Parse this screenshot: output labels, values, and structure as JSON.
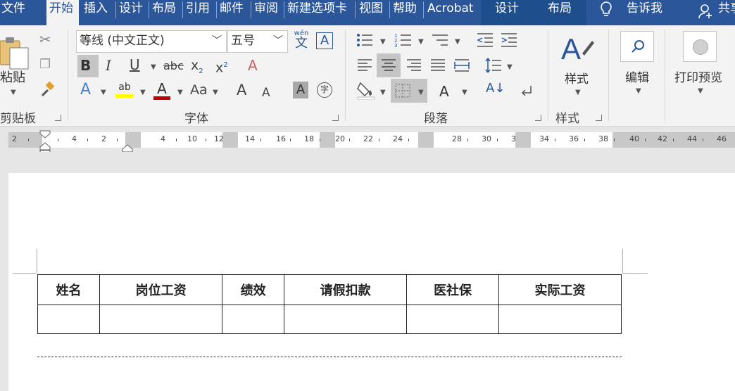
{
  "tabs": [
    "文件",
    "开始",
    "插入",
    "设计",
    "布局",
    "引用",
    "邮件",
    "审阅",
    "新建选项卡",
    "视图",
    "帮助",
    "Acrobat",
    "设计",
    "布局"
  ],
  "tell_me": "告诉我",
  "share": "共享",
  "clipboard": {
    "paste": "粘贴",
    "group": "剪贴板"
  },
  "font": {
    "name": "等线 (中文正文)",
    "size": "五号",
    "phonetic": "wén",
    "phonetic_char": "文",
    "char_border": "A",
    "group": "字体",
    "bold": "B",
    "italic": "I",
    "underline": "U",
    "strike": "abc",
    "sub": "x",
    "sup": "x",
    "change_case": "Aa",
    "grow": "A",
    "shrink": "A",
    "enclose": "字"
  },
  "paragraph": {
    "group": "段落"
  },
  "styles": {
    "label": "样式",
    "group": "样式"
  },
  "editing": {
    "label": "编辑"
  },
  "print_preview": {
    "label": "打印预览"
  },
  "ruler_numbers": [
    "2",
    "4",
    "2",
    "4",
    "8",
    "10",
    "12",
    "14",
    "16",
    "18",
    "20",
    "22",
    "24",
    "28",
    "30",
    "3",
    "34",
    "36",
    "38",
    "40",
    "42",
    "44",
    "46"
  ],
  "table": {
    "headers": [
      "姓名",
      "岗位工资",
      "绩效",
      "请假扣款",
      "医社保",
      "实际工资"
    ],
    "rows": [
      [
        "",
        "",
        "",
        "",
        "",
        ""
      ]
    ]
  },
  "colors": {
    "accent": "#2b579a",
    "highlight": "#ffff00",
    "font_color": "#c00000"
  }
}
